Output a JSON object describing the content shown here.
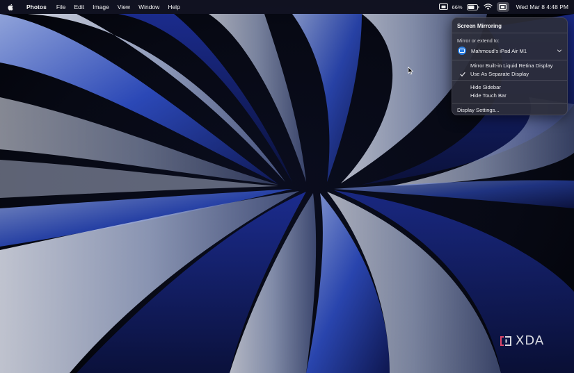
{
  "menubar": {
    "apple_icon": "apple-logo-icon",
    "app_name": "Photos",
    "menus": [
      "File",
      "Edit",
      "Image",
      "View",
      "Window",
      "Help"
    ],
    "status": {
      "battery_percent": "66%",
      "clock": "Wed Mar 8  4:48 PM",
      "icons": [
        "screen-mirroring-icon",
        "battery-icon",
        "wifi-icon",
        "control-center-icon"
      ]
    }
  },
  "panel": {
    "title": "Screen Mirroring",
    "subtitle": "Mirror or extend to:",
    "device": {
      "name": "Mahmoud’s iPad Air M1",
      "icon": "ipad-icon"
    },
    "options": [
      {
        "label": "Mirror Built-in Liquid Retina Display",
        "checked": false
      },
      {
        "label": "Use As Separate Display",
        "checked": true
      },
      {
        "label": "Hide Sidebar",
        "checked": false
      },
      {
        "label": "Hide Touch Bar",
        "checked": false
      }
    ],
    "settings_label": "Display Settings..."
  },
  "watermark": {
    "text": "XDA",
    "color": "#e0476b"
  }
}
